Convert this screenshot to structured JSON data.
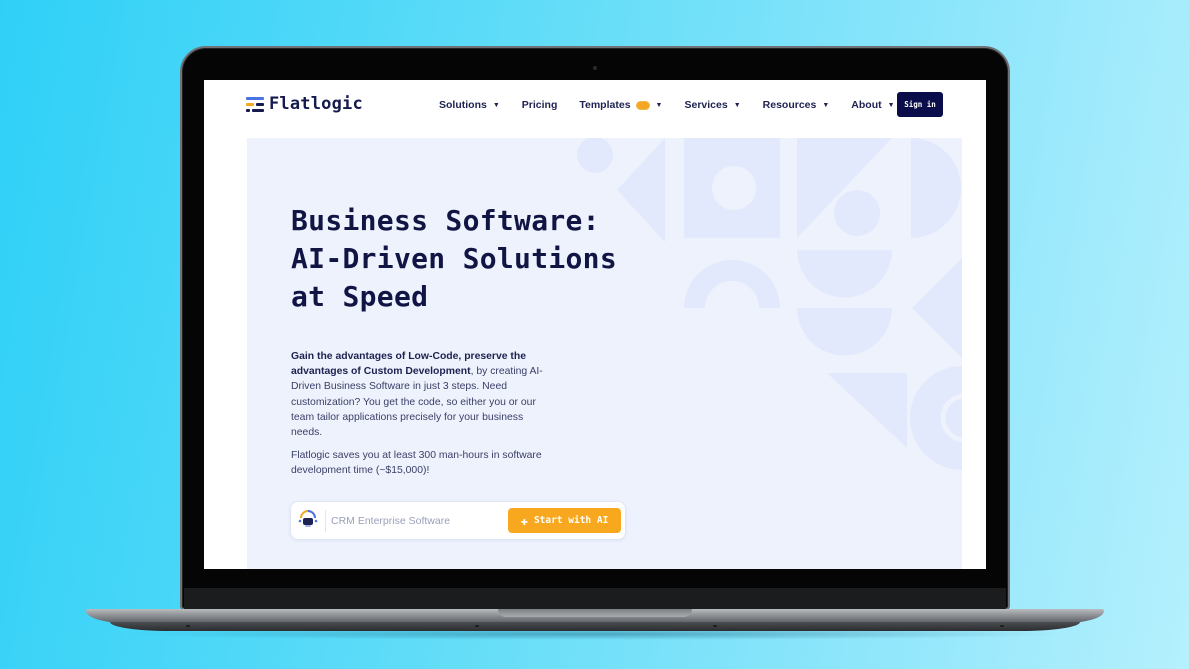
{
  "brand": {
    "name": "Flatlogic",
    "logo_icon": "flatlogic-logo-icon",
    "logo_colors": [
      "#4a73e8",
      "#f5a623",
      "#151a4f"
    ]
  },
  "nav": {
    "items": [
      {
        "label": "Solutions",
        "has_dropdown": true
      },
      {
        "label": "Pricing",
        "has_dropdown": false
      },
      {
        "label": "Templates",
        "has_dropdown": true,
        "badge": true
      },
      {
        "label": "Services",
        "has_dropdown": true
      },
      {
        "label": "Resources",
        "has_dropdown": true
      },
      {
        "label": "About",
        "has_dropdown": true
      }
    ],
    "dropdown_icon": "caret-down-icon",
    "sign_in_label": "Sign in"
  },
  "hero": {
    "title_lines": [
      "Business Software:",
      "AI-Driven Solutions",
      "at Speed"
    ],
    "description": {
      "bold_1": "Gain the advantages of Low-Code, preserve the advantages of Custom Development",
      "rest_1": ", by creating AI-Driven Business Software in just 3 steps. Need customization? You get the code, so either you or our team tailor applications precisely for your business needs."
    },
    "savings_text": "Flatlogic saves you at least 300 man-hours in software development time (~$15,000)!",
    "prompt": {
      "placeholder": "CRM Enterprise Software",
      "value": "",
      "icon": "ai-robot-icon",
      "button_label": "Start with AI",
      "button_icon": "plus-icon"
    }
  },
  "colors": {
    "background_gradient": [
      "#2fd0f7",
      "#b5f0fd"
    ],
    "navy": "#111544",
    "sign_in_bg": "#0b0d4a",
    "accent_orange": "#f8a81e",
    "hero_bg": "#eef2fd",
    "shape_color": "#e2e8fb"
  }
}
